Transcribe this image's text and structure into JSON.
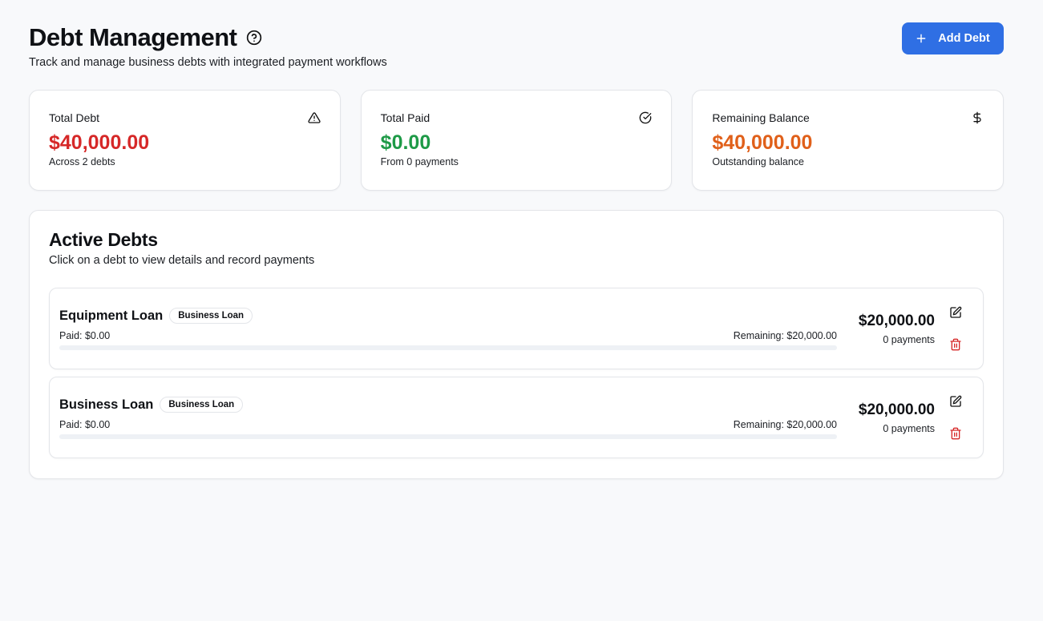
{
  "header": {
    "title": "Debt Management",
    "subtitle": "Track and manage business debts with integrated payment workflows",
    "add_button_label": "Add Debt"
  },
  "stats": [
    {
      "label": "Total Debt",
      "value": "$40,000.00",
      "caption": "Across 2 debts",
      "color": "#d62828",
      "icon": "alert-triangle-icon"
    },
    {
      "label": "Total Paid",
      "value": "$0.00",
      "caption": "From 0 payments",
      "color": "#1e9a47",
      "icon": "check-circle-icon"
    },
    {
      "label": "Remaining Balance",
      "value": "$40,000.00",
      "caption": "Outstanding balance",
      "color": "#e0601a",
      "icon": "dollar-icon"
    }
  ],
  "active_debts": {
    "title": "Active Debts",
    "subtitle": "Click on a debt to view details and record payments",
    "items": [
      {
        "name": "Equipment Loan",
        "type": "Business Loan",
        "paid": "Paid: $0.00",
        "remaining": "Remaining: $20,000.00",
        "amount": "$20,000.00",
        "payments": "0 payments",
        "progress": 0
      },
      {
        "name": "Business Loan",
        "type": "Business Loan",
        "paid": "Paid: $0.00",
        "remaining": "Remaining: $20,000.00",
        "amount": "$20,000.00",
        "payments": "0 payments",
        "progress": 0
      }
    ]
  },
  "colors": {
    "accent": "#2f6fe4",
    "danger": "#d62828"
  }
}
